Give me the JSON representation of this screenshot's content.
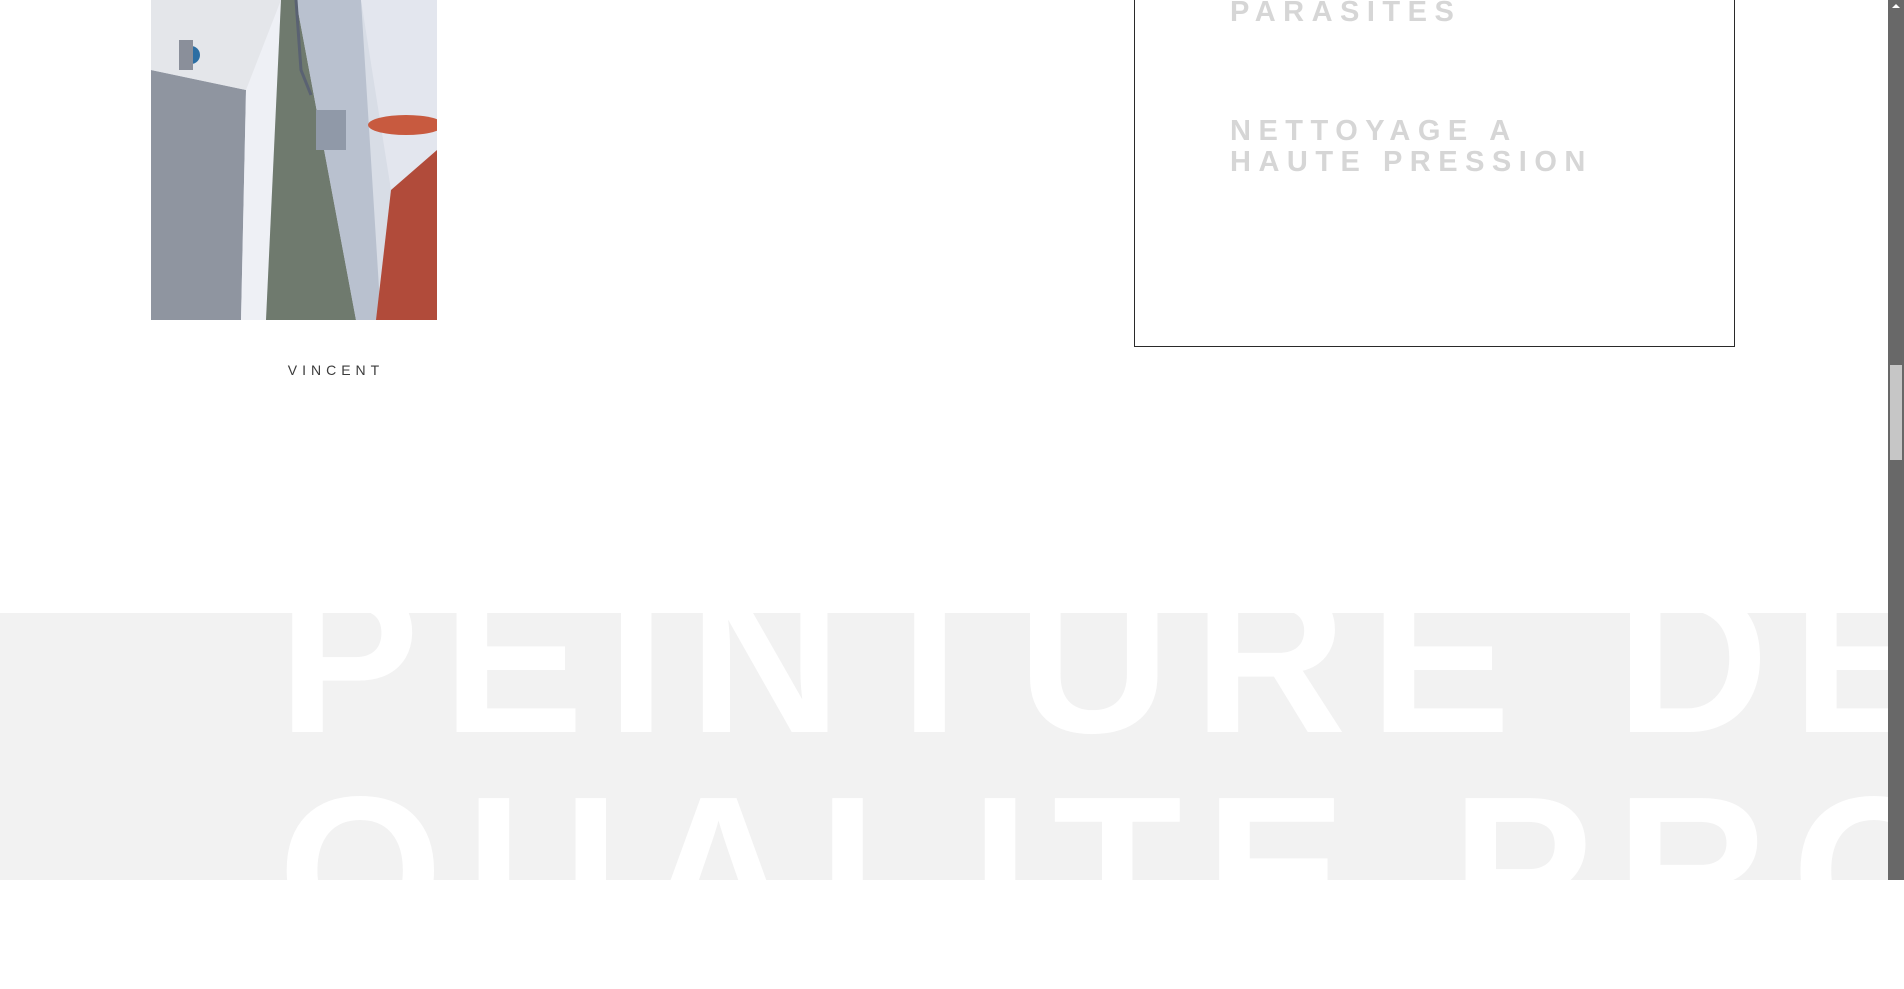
{
  "gallery": {
    "caption": "VINCENT"
  },
  "services": {
    "items": [
      "PARASITES",
      "NETTOYAGE A HAUTE PRESSION"
    ]
  },
  "hero": {
    "headline_line1": "PEINTURE DE",
    "headline_line2": "QUALITE PRO"
  },
  "colors": {
    "band": "#f2f2f2",
    "service_text": "#d6d6d6",
    "scrollbar": "#686868"
  },
  "scrollbar": {
    "up_icon": "scroll-up-arrow-icon"
  }
}
